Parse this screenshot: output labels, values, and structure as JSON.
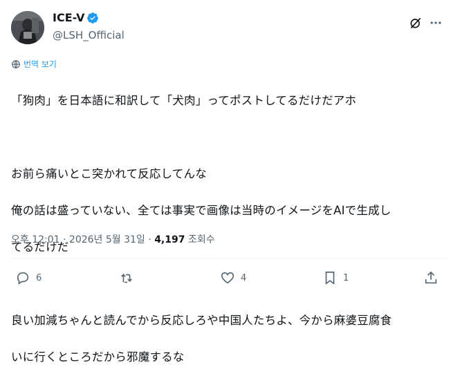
{
  "author": {
    "display_name": "ICE-V",
    "handle": "@LSH_Official",
    "verified_icon": "verified-badge-icon",
    "accent_color": "#1d9bf0"
  },
  "header": {
    "grok_icon": "grok-icon",
    "more_icon": "more-icon"
  },
  "translate": {
    "label": "번역 보기",
    "icon": "globe-icon"
  },
  "tweet": {
    "lines": [
      "「狗肉」を日本語に和訳して「犬肉」ってポストしてるだけだアホ",
      "",
      "お前ら痛いとこ突かれて反応してんな",
      "俺の話は盛っていない、全ては事実で画像は当時のイメージをAIで生成し",
      "てるだけだ",
      "",
      "良い加減ちゃんと読んでから反応しろや中国人たちよ、今から麻婆豆腐食",
      "いに行くところだから邪魔するな"
    ]
  },
  "meta": {
    "time": "오후 12:01",
    "separator": "·",
    "date": "2026년 5월 31일",
    "views_count": "4,197",
    "views_label": "조회수"
  },
  "actions": {
    "reply": {
      "icon": "reply-icon",
      "count": "6"
    },
    "retweet": {
      "icon": "retweet-icon",
      "count": ""
    },
    "like": {
      "icon": "heart-icon",
      "count": "4"
    },
    "bookmark": {
      "icon": "bookmark-icon",
      "count": "1"
    },
    "share": {
      "icon": "share-icon"
    }
  }
}
